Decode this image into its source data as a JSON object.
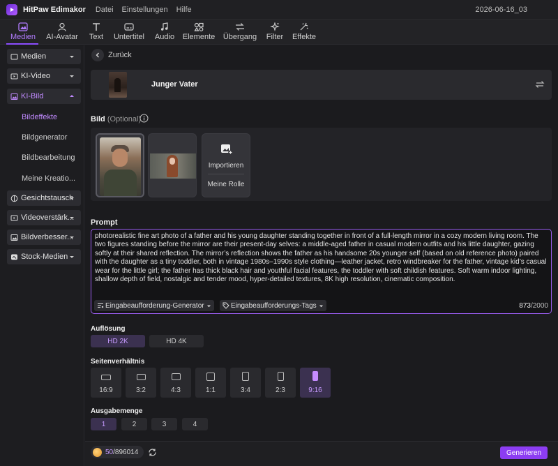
{
  "app": {
    "name": "HitPaw Edimakor",
    "menu": [
      "Datei",
      "Einstellungen",
      "Hilfe"
    ],
    "project": "2026-06-16_03"
  },
  "toolbar": {
    "tabs": [
      {
        "label": "Medien",
        "icon": "media-icon",
        "active": true
      },
      {
        "label": "AI-Avatar",
        "icon": "avatar-icon",
        "active": false
      },
      {
        "label": "Text",
        "icon": "text-icon",
        "active": false
      },
      {
        "label": "Untertitel",
        "icon": "subtitle-icon",
        "active": false
      },
      {
        "label": "Audio",
        "icon": "audio-icon",
        "active": false
      },
      {
        "label": "Elemente",
        "icon": "elements-icon",
        "active": false
      },
      {
        "label": "Übergang",
        "icon": "transition-icon",
        "active": false
      },
      {
        "label": "Filter",
        "icon": "filter-icon",
        "active": false
      },
      {
        "label": "Effekte",
        "icon": "effects-icon",
        "active": false
      }
    ]
  },
  "sidebar": {
    "items": [
      {
        "label": "Medien",
        "icon": "media-icon"
      },
      {
        "label": "KI-Video",
        "icon": "video-icon"
      },
      {
        "label": "KI-Bild",
        "icon": "image-icon",
        "open": true
      },
      {
        "label": "Gesichtstausch",
        "icon": "face-swap-icon"
      },
      {
        "label": "Videoverstärk...",
        "icon": "video-enhance-icon"
      },
      {
        "label": "Bildverbesser...",
        "icon": "image-enhance-icon"
      },
      {
        "label": "Stock-Medien",
        "icon": "stock-icon"
      }
    ],
    "sub_items": [
      "Bildeffekte",
      "Bildgenerator",
      "Bildbearbeitung",
      "Meine Kreatio..."
    ],
    "active_sub": "Bildeffekte"
  },
  "main": {
    "back_label": "Zurück",
    "template_title": "Junger Vater",
    "image_section": {
      "label": "Bild",
      "optional": "(Optional)",
      "import_label": "Importieren",
      "my_role_label": "Meine Rolle"
    },
    "prompt": {
      "label": "Prompt",
      "text": "photorealistic fine art photo of a father and his young daughter standing together in front of a full-length mirror in a cozy modern living room. The two figures standing before the mirror are their present-day selves: a middle-aged father in casual modern outfits and his little daughter, gazing softly at their shared reflection. The mirror’s reflection shows the father as his handsome 20s younger self (based on old reference photo) paired with the daughter as a tiny toddler, both in vintage 1980s–1990s style clothing—leather jacket, retro windbreaker for the father, vintage kid’s casual wear for the little girl; the father has thick black hair and youthful facial features, the toddler with soft childish features. Soft warm indoor lighting, shallow depth of field, nostalgic and tender mood, hyper-detailed textures, 8K high resolution, cinematic composition.",
      "generator_label": "Eingabeaufforderung-Generator",
      "tags_label": "Eingabeaufforderungs-Tags",
      "char_count": "873",
      "char_max": "/2000"
    },
    "resolution": {
      "label": "Auflösung",
      "options": [
        "HD 2K",
        "HD 4K"
      ],
      "selected": "HD 2K"
    },
    "aspect": {
      "label": "Seitenverhältnis",
      "options": [
        "16:9",
        "3:2",
        "4:3",
        "1:1",
        "3:4",
        "2:3",
        "9:16"
      ],
      "selected": "9:16"
    },
    "output": {
      "label": "Ausgabemenge",
      "options": [
        "1",
        "2",
        "3",
        "4"
      ],
      "selected": "1"
    }
  },
  "footer": {
    "credits_used": "50",
    "credits_total": "/896014",
    "generate_label": "Generieren"
  },
  "colors": {
    "accent": "#8c3df2",
    "accent_text": "#c79bff",
    "background": "#1b1b1e"
  }
}
